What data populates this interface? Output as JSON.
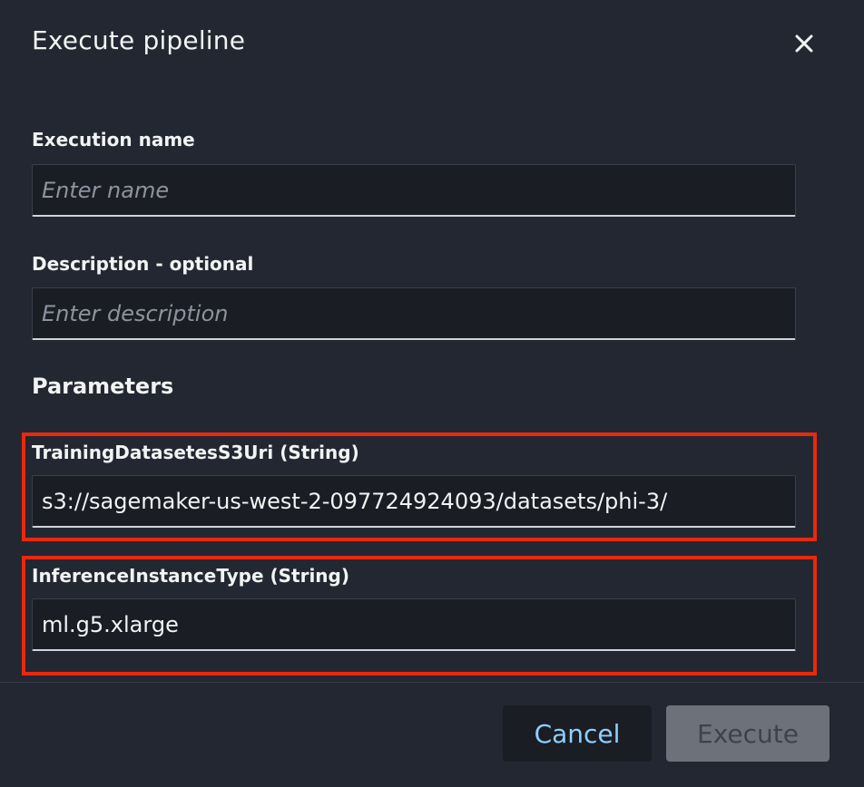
{
  "dialog": {
    "title": "Execute pipeline",
    "close_icon": "close-icon"
  },
  "fields": {
    "execution_name": {
      "label": "Execution name",
      "placeholder": "Enter name",
      "value": ""
    },
    "description": {
      "label": "Description - optional",
      "placeholder": "Enter description",
      "value": ""
    }
  },
  "parameters": {
    "heading": "Parameters",
    "items": [
      {
        "label": "TrainingDatasetesS3Uri (String)",
        "value": "s3://sagemaker-us-west-2-097724924093/datasets/phi-3/"
      },
      {
        "label": "InferenceInstanceType (String)",
        "value": "ml.g5.xlarge"
      }
    ],
    "highlight_color": "#e8290f"
  },
  "footer": {
    "cancel_label": "Cancel",
    "execute_label": "Execute"
  },
  "colors": {
    "background": "#232731",
    "link_blue": "#8fd0ff",
    "disabled_button": "#6d717a"
  }
}
